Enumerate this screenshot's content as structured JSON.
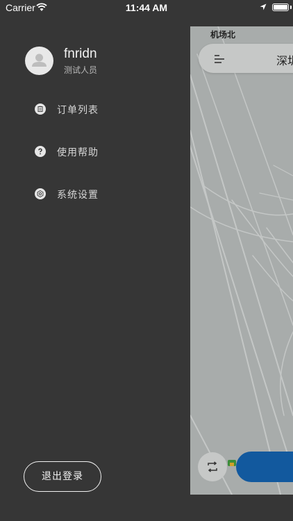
{
  "status_bar": {
    "carrier": "Carrier",
    "time": "11:44 AM",
    "icons": [
      "wifi-icon",
      "location-arrow-icon",
      "battery-icon"
    ]
  },
  "drawer": {
    "user": {
      "name": "fnridn",
      "role": "测试人员",
      "avatar_icon": "user-avatar-icon"
    },
    "menu": [
      {
        "label": "订单列表",
        "icon": "clipboard-icon"
      },
      {
        "label": "使用帮助",
        "icon": "help-icon"
      },
      {
        "label": "系统设置",
        "icon": "settings-icon"
      }
    ],
    "logout_label": "退出登录"
  },
  "map": {
    "place_label": "机场北",
    "city_label": "深圳",
    "menu_icon": "menu-lines-icon",
    "swap_icon": "swap-icon"
  },
  "colors": {
    "drawer_bg": "#363636",
    "map_bg": "#a8acab",
    "primary_button": "#12599e",
    "text_light": "#f2f2f2"
  }
}
